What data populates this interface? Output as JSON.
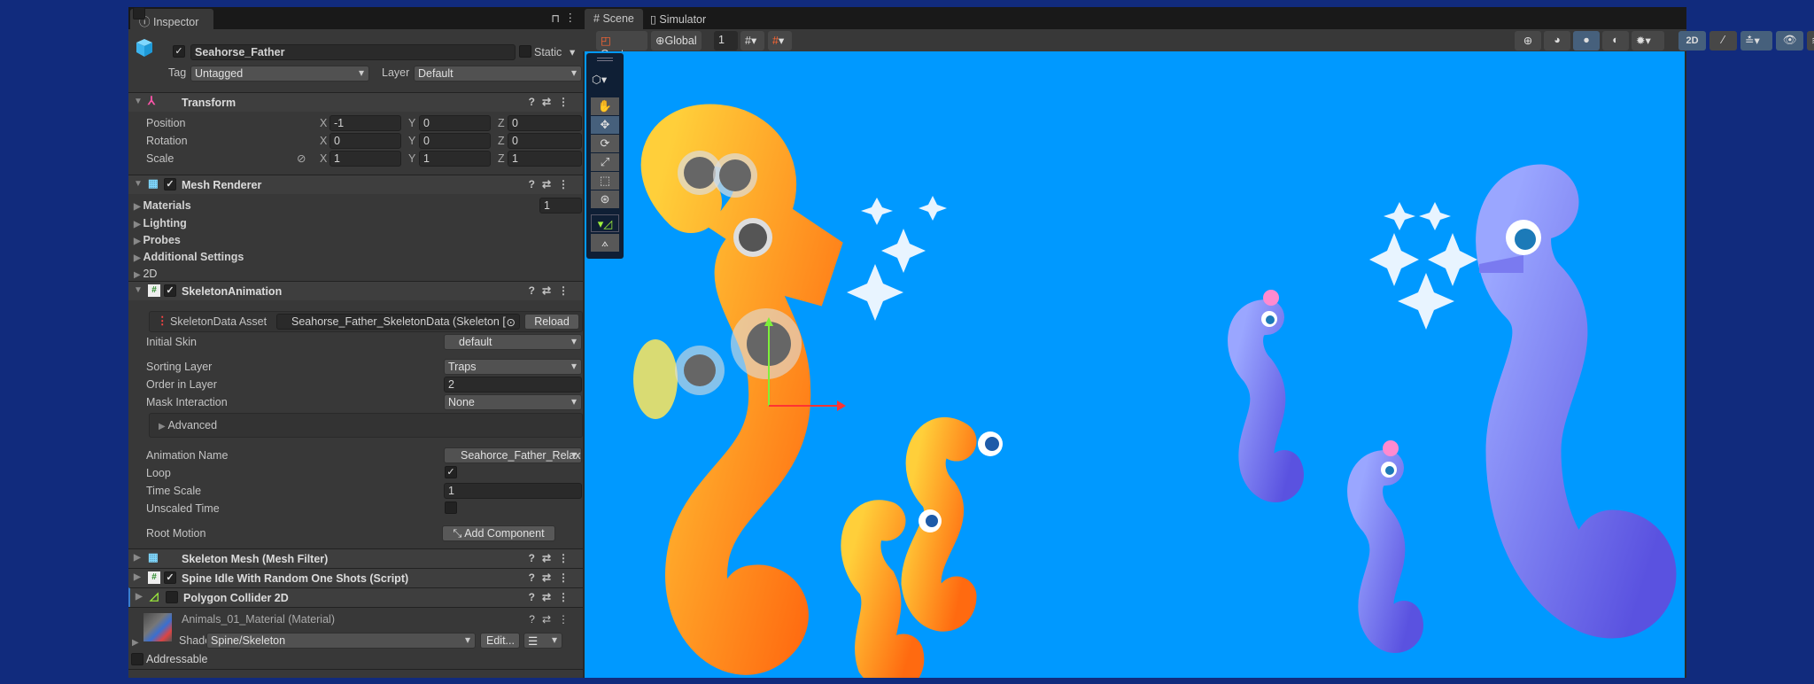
{
  "inspector": {
    "tab_label": "Inspector",
    "object_name": "Seahorse_Father",
    "static_label": "Static",
    "tag_label": "Tag",
    "tag_value": "Untagged",
    "layer_label": "Layer",
    "layer_value": "Default",
    "transform": {
      "title": "Transform",
      "position": {
        "label": "Position",
        "x": "-1",
        "y": "0",
        "z": "0"
      },
      "rotation": {
        "label": "Rotation",
        "x": "0",
        "y": "0",
        "z": "0"
      },
      "scale": {
        "label": "Scale",
        "x": "1",
        "y": "1",
        "z": "1"
      },
      "axis": {
        "x": "X",
        "y": "Y",
        "z": "Z"
      }
    },
    "mesh_renderer": {
      "title": "Mesh Renderer",
      "materials": "Materials",
      "materials_count": "1",
      "lighting": "Lighting",
      "probes": "Probes",
      "additional": "Additional Settings",
      "two_d": "2D"
    },
    "skeleton_animation": {
      "title": "SkeletonAnimation",
      "data_asset_label": "SkeletonData Asset",
      "data_asset_value": "Seahorse_Father_SkeletonData (Skeleton [",
      "reload": "Reload",
      "initial_skin_label": "Initial Skin",
      "initial_skin": "default",
      "sorting_layer_label": "Sorting Layer",
      "sorting_layer": "Traps",
      "order_label": "Order in Layer",
      "order": "2",
      "mask_label": "Mask Interaction",
      "mask": "None",
      "advanced": "Advanced",
      "anim_name_label": "Animation Name",
      "anim_name": "Seahorce_Father_Relax",
      "loop_label": "Loop",
      "loop": true,
      "time_scale_label": "Time Scale",
      "time_scale": "1",
      "unscaled_label": "Unscaled Time",
      "unscaled": false,
      "root_motion_label": "Root Motion",
      "add_component": "Add Component"
    },
    "components": [
      {
        "title": "Skeleton Mesh (Mesh Filter)"
      },
      {
        "title": "Spine Idle With Random One Shots (Script)"
      },
      {
        "title": "Polygon Collider 2D"
      }
    ],
    "material": {
      "title": "Animals_01_Material (Material)",
      "shader_label": "Shader",
      "shader": "Spine/Skeleton",
      "edit": "Edit..."
    },
    "addressable": "Addressable"
  },
  "scene": {
    "tabs": [
      "Scene",
      "Simulator"
    ],
    "pivot": "Center",
    "space": "Global",
    "grid_size": "1",
    "mode_2d": "2D"
  },
  "colors": {
    "scene_bg": "#0099ff",
    "orange": "#ff8a1a",
    "purple": "#6f6fe8"
  }
}
